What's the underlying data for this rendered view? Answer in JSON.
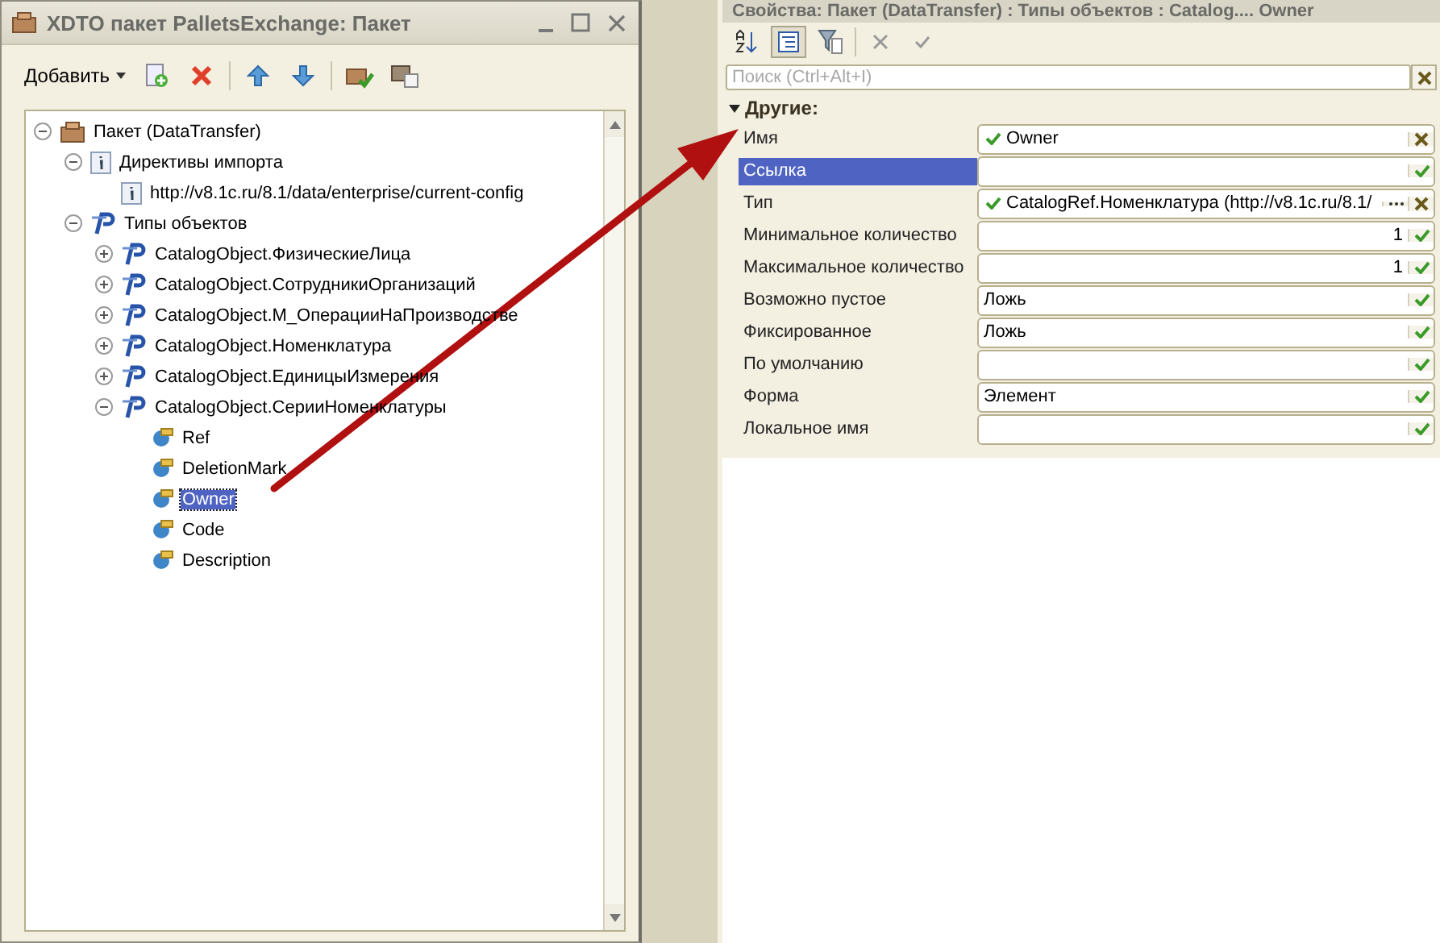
{
  "left_window": {
    "title": "XDTO пакет PalletsExchange: Пакет",
    "toolbar": {
      "add_label": "Добавить"
    },
    "tree": [
      {
        "label": "Пакет (DataTransfer)",
        "kind": "package",
        "expanded": true,
        "selected": false,
        "children": [
          {
            "label": "Директивы импорта",
            "kind": "info",
            "expanded": true,
            "selected": false,
            "children": [
              {
                "label": "http://v8.1c.ru/8.1/data/enterprise/current-config",
                "kind": "info",
                "selected": false
              }
            ]
          },
          {
            "label": "Типы объектов",
            "kind": "type",
            "expanded": true,
            "selected": false,
            "children": [
              {
                "label": "CatalogObject.ФизическиеЛица",
                "kind": "type",
                "expanded": false,
                "selected": false
              },
              {
                "label": "CatalogObject.СотрудникиОрганизаций",
                "kind": "type",
                "expanded": false,
                "selected": false
              },
              {
                "label": "CatalogObject.М_ОперацииНаПроизводстве",
                "kind": "type",
                "expanded": false,
                "selected": false
              },
              {
                "label": "CatalogObject.Номенклатура",
                "kind": "type",
                "expanded": false,
                "selected": false
              },
              {
                "label": "CatalogObject.ЕдиницыИзмерения",
                "kind": "type",
                "expanded": false,
                "selected": false
              },
              {
                "label": "CatalogObject.СерииНоменклатуры",
                "kind": "type",
                "expanded": true,
                "selected": false,
                "children": [
                  {
                    "label": "Ref",
                    "kind": "property",
                    "selected": false
                  },
                  {
                    "label": "DeletionMark",
                    "kind": "property",
                    "selected": false
                  },
                  {
                    "label": "Owner",
                    "kind": "property",
                    "selected": true
                  },
                  {
                    "label": "Code",
                    "kind": "property",
                    "selected": false
                  },
                  {
                    "label": "Description",
                    "kind": "property",
                    "selected": false
                  }
                ]
              }
            ]
          }
        ]
      }
    ]
  },
  "right_window": {
    "title": "Свойства: Пакет (DataTransfer) : Типы объектов : Catalog.... Owner",
    "search": {
      "placeholder": "Поиск (Ctrl+Alt+I)"
    },
    "group": {
      "title": "Другие:",
      "expanded": true
    },
    "properties": [
      {
        "label": "Имя",
        "kind": "checked_text",
        "value": "Owner",
        "selected": false
      },
      {
        "label": "Ссылка",
        "kind": "choice",
        "selected": true
      },
      {
        "label": "Тип",
        "kind": "reference",
        "value": "CatalogRef.Номенклатура (http://v8.1c.ru/8.1/",
        "selected": false
      },
      {
        "label": "Минимальное количество",
        "kind": "number",
        "value": "1",
        "selected": false
      },
      {
        "label": "Максимальное количество",
        "kind": "number",
        "value": "1",
        "selected": false
      },
      {
        "label": "Возможно пустое",
        "kind": "choice",
        "value": "Ложь",
        "selected": false
      },
      {
        "label": "Фиксированное",
        "kind": "choice",
        "value": "Ложь",
        "selected": false
      },
      {
        "label": "По умолчанию",
        "kind": "choice",
        "selected": false
      },
      {
        "label": "Форма",
        "kind": "choice",
        "value": "Элемент",
        "selected": false
      },
      {
        "label": "Локальное имя",
        "kind": "choice",
        "selected": false
      }
    ]
  }
}
